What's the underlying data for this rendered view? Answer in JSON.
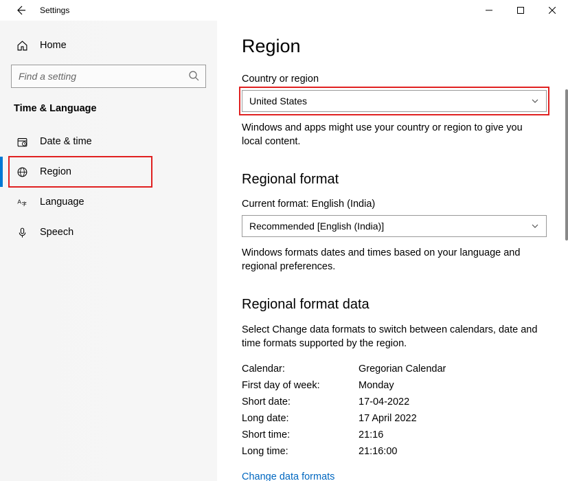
{
  "titlebar": {
    "title": "Settings"
  },
  "sidebar": {
    "home": "Home",
    "search_placeholder": "Find a setting",
    "section": "Time & Language",
    "items": [
      {
        "label": "Date & time"
      },
      {
        "label": "Region"
      },
      {
        "label": "Language"
      },
      {
        "label": "Speech"
      }
    ]
  },
  "main": {
    "title": "Region",
    "country_label": "Country or region",
    "country_value": "United States",
    "country_hint": "Windows and apps might use your country or region to give you local content.",
    "format_heading": "Regional format",
    "current_format_label": "Current format: English (India)",
    "format_value": "Recommended [English (India)]",
    "format_hint": "Windows formats dates and times based on your language and regional preferences.",
    "format_data_heading": "Regional format data",
    "format_data_hint": "Select Change data formats to switch between calendars, date and time formats supported by the region.",
    "rows": [
      {
        "k": "Calendar:",
        "v": "Gregorian Calendar"
      },
      {
        "k": "First day of week:",
        "v": "Monday"
      },
      {
        "k": "Short date:",
        "v": "17-04-2022"
      },
      {
        "k": "Long date:",
        "v": "17 April 2022"
      },
      {
        "k": "Short time:",
        "v": "21:16"
      },
      {
        "k": "Long time:",
        "v": "21:16:00"
      }
    ],
    "change_link": "Change data formats"
  }
}
